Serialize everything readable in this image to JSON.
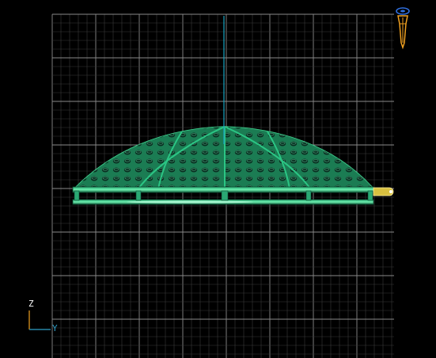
{
  "viewport": {
    "background_color": "#000000",
    "grid_color": "#3a3a3a",
    "grid_major_color": "#8a8a8a",
    "vertical_axis_color": "#19a7c4",
    "model_color": "#1f8a5f",
    "model_highlight_color": "#3fd38f",
    "model_edge_color": "#0d4d33",
    "gizmo_tip_color": "#e6d24a",
    "gizmo_accent_color": "#ff3b2f"
  },
  "axis_indicator": {
    "z_label": "Z",
    "y_label": "Y",
    "z_color": "#ffffff",
    "y_color": "#2f9fc8"
  },
  "nav_widget": {
    "icon": "camera-orbit-icon",
    "body_color": "#f0a020",
    "top_color": "#2f6fe0"
  }
}
